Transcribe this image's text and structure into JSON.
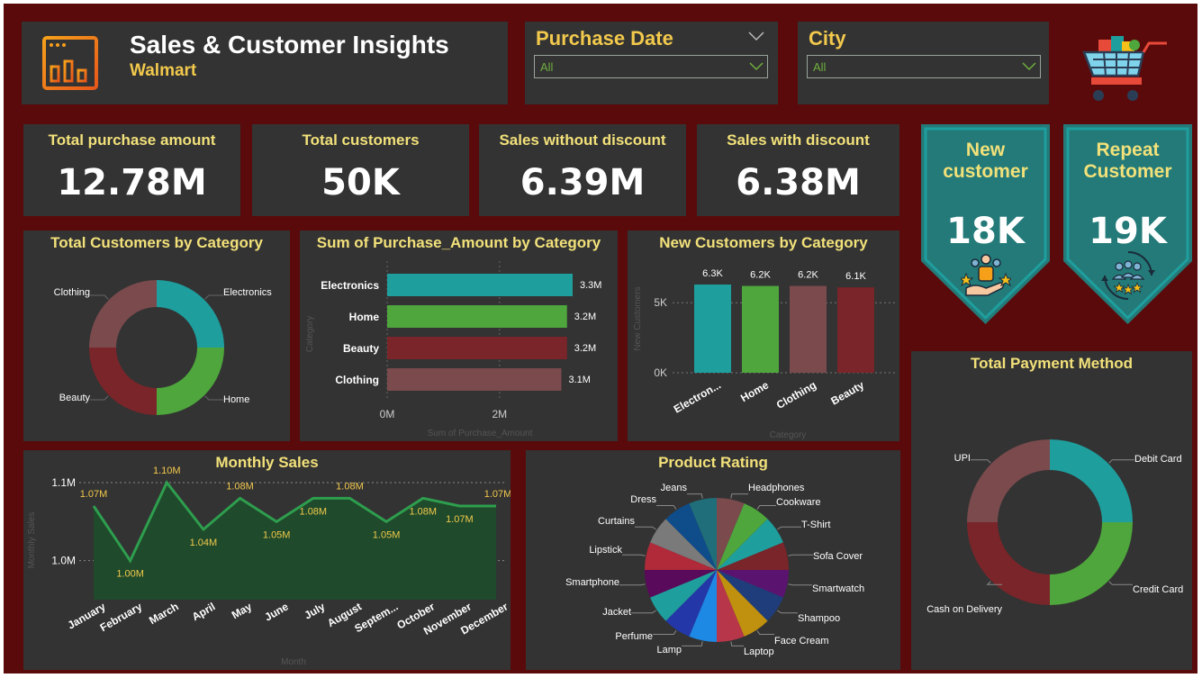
{
  "header": {
    "title": "Sales & Customer Insights",
    "subtitle": "Walmart"
  },
  "filters": {
    "purchase_date": {
      "label": "Purchase Date",
      "value": "All"
    },
    "city": {
      "label": "City",
      "value": "All"
    }
  },
  "kpis": [
    {
      "label": "Total purchase amount",
      "value": "12.78M"
    },
    {
      "label": "Total customers",
      "value": "50K"
    },
    {
      "label": "Sales without discount",
      "value": "6.39M"
    },
    {
      "label": "Sales with discount",
      "value": "6.38M"
    }
  ],
  "badges": [
    {
      "title_line1": "New",
      "title_line2": "customer",
      "value": "18K"
    },
    {
      "title_line1": "Repeat",
      "title_line2": "Customer",
      "value": "19K"
    }
  ],
  "icons": {
    "dashboard": "dashboard-icon",
    "cart": "shopping-cart-icon",
    "new_customer": "customer-group-icon",
    "repeat_customer": "repeat-cycle-icon"
  },
  "colors": {
    "background": "#5a0a0a",
    "panel": "#333333",
    "teal": "#1f9e9e",
    "green": "#4ea63c",
    "red": "#7a2529",
    "mauve": "#7a4a4d",
    "yellow_title": "#f2e17a",
    "badge": "#237a78"
  },
  "chart_data": [
    {
      "id": "customers_by_category",
      "type": "pie",
      "title": "Total Customers by Category",
      "donut": true,
      "categories": [
        "Electronics",
        "Home",
        "Beauty",
        "Clothing"
      ],
      "values": [
        12.5,
        12.5,
        12.5,
        12.5
      ],
      "colors": [
        "#1f9e9e",
        "#4ea63c",
        "#7a2529",
        "#7a4a4d"
      ]
    },
    {
      "id": "purchase_by_category",
      "type": "bar",
      "orientation": "horizontal",
      "title": "Sum of Purchase_Amount by Category",
      "xlabel": "Sum of Purchase_Amount",
      "ylabel": "Category",
      "categories": [
        "Electronics",
        "Home",
        "Beauty",
        "Clothing"
      ],
      "values": [
        3.3,
        3.2,
        3.2,
        3.1
      ],
      "data_labels": [
        "3.3M",
        "3.2M",
        "3.2M",
        "3.1M"
      ],
      "colors": [
        "#1f9e9e",
        "#4ea63c",
        "#7a2529",
        "#7a4a4d"
      ],
      "xticks": [
        {
          "value": 0,
          "label": "0M"
        },
        {
          "value": 2,
          "label": "2M"
        }
      ],
      "xlim": [
        0,
        3.3
      ],
      "grid": true
    },
    {
      "id": "new_customers_by_category",
      "type": "bar",
      "title": "New Customers by Category",
      "xlabel": "Category",
      "ylabel": "New Customers",
      "categories": [
        "Electron...",
        "Home",
        "Clothing",
        "Beauty"
      ],
      "values": [
        6.3,
        6.2,
        6.2,
        6.1
      ],
      "data_labels": [
        "6.3K",
        "6.2K",
        "6.2K",
        "6.1K"
      ],
      "colors": [
        "#1f9e9e",
        "#4ea63c",
        "#7a4a4d",
        "#7a2529"
      ],
      "yticks": [
        {
          "value": 0,
          "label": "0K"
        },
        {
          "value": 5,
          "label": "5K"
        }
      ],
      "ylim": [
        0,
        6.3
      ],
      "grid": true
    },
    {
      "id": "monthly_sales",
      "type": "area",
      "title": "Monthly Sales",
      "xlabel": "Month",
      "ylabel": "Monthly Sales",
      "categories": [
        "January",
        "February",
        "March",
        "April",
        "May",
        "June",
        "July",
        "August",
        "Septem...",
        "October",
        "November",
        "December"
      ],
      "values": [
        1.07,
        1.0,
        1.1,
        1.04,
        1.08,
        1.05,
        1.08,
        1.08,
        1.05,
        1.08,
        1.07,
        1.07
      ],
      "data_labels": [
        "1.07M",
        "1.00M",
        "1.10M",
        "1.04M",
        "1.08M",
        "1.05M",
        "1.08M",
        "1.08M",
        "1.05M",
        "1.08M",
        "1.07M",
        "1.07M"
      ],
      "yticks": [
        {
          "value": 1.0,
          "label": "1.0M"
        },
        {
          "value": 1.1,
          "label": "1.1M"
        }
      ],
      "ylim": [
        0.95,
        1.1
      ],
      "color": "#2e9e4e",
      "grid": true
    },
    {
      "id": "product_rating",
      "type": "pie",
      "title": "Product Rating",
      "categories": [
        "Headphones",
        "Cookware",
        "T-Shirt",
        "Sofa Cover",
        "Smartwatch",
        "Shampoo",
        "Face Cream",
        "Laptop",
        "Lamp",
        "Perfume",
        "Jacket",
        "Smartphone",
        "Lipstick",
        "Curtains",
        "Dress",
        "Jeans"
      ],
      "values": [
        1,
        1,
        1,
        1,
        1,
        1,
        1,
        1,
        1,
        1,
        1,
        1,
        1,
        1,
        1,
        1
      ],
      "colors": [
        "#7a4a4d",
        "#4ea63c",
        "#1f9e9e",
        "#7a2529",
        "#5a1470",
        "#1f3d7a",
        "#c0900f",
        "#b8364a",
        "#1e88e5",
        "#2437a8",
        "#1f9e9e",
        "#5a0a5a",
        "#b02a3a",
        "#7a7a7a",
        "#0f4c8a",
        "#1f6e7a"
      ]
    },
    {
      "id": "payment_method",
      "type": "pie",
      "title": "Total Payment Method",
      "donut": true,
      "categories": [
        "Debit Card",
        "Credit Card",
        "Cash on Delivery",
        "UPI"
      ],
      "values": [
        25,
        25,
        25,
        25
      ],
      "colors": [
        "#1f9e9e",
        "#4ea63c",
        "#7a2529",
        "#7a4a4d"
      ]
    }
  ]
}
